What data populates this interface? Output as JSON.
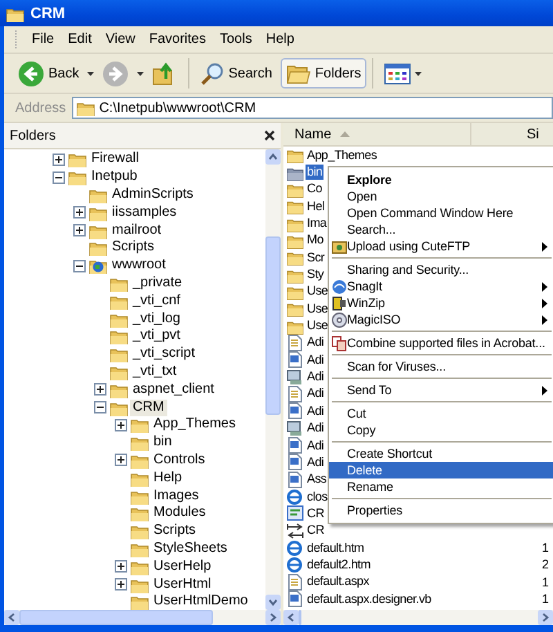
{
  "window": {
    "title": "CRM"
  },
  "menu_bar": [
    "File",
    "Edit",
    "View",
    "Favorites",
    "Tools",
    "Help"
  ],
  "toolbar": [
    {
      "kind": "back",
      "label": "Back",
      "disabled": false
    },
    {
      "kind": "forward",
      "disabled": true
    },
    {
      "kind": "up"
    },
    {
      "kind": "search",
      "label": "Search",
      "selected": false
    },
    {
      "kind": "folders",
      "label": "Folders",
      "selected": true
    },
    {
      "kind": "views"
    }
  ],
  "address_bar": {
    "label": "Address",
    "value": "C:\\Inetpub\\wwwroot\\CRM"
  },
  "folders_pane": {
    "title": "Folders",
    "tree": [
      {
        "label": "Firewall",
        "kind": "folder",
        "expanded": false,
        "selected": false
      },
      {
        "label": "Inetpub",
        "kind": "folder",
        "expanded": true,
        "selected": false,
        "children": [
          {
            "label": "AdminScripts",
            "kind": "folder",
            "selected": false
          },
          {
            "label": "iissamples",
            "kind": "folder",
            "expanded": false,
            "selected": false
          },
          {
            "label": "mailroot",
            "kind": "folder",
            "expanded": false,
            "selected": false
          },
          {
            "label": "Scripts",
            "kind": "folder",
            "selected": false
          },
          {
            "label": "wwwroot",
            "kind": "web-folder",
            "expanded": true,
            "selected": false,
            "children": [
              {
                "label": "_private",
                "kind": "folder",
                "selected": false
              },
              {
                "label": "_vti_cnf",
                "kind": "folder",
                "selected": false
              },
              {
                "label": "_vti_log",
                "kind": "folder",
                "selected": false
              },
              {
                "label": "_vti_pvt",
                "kind": "folder",
                "selected": false
              },
              {
                "label": "_vti_script",
                "kind": "folder",
                "selected": false
              },
              {
                "label": "_vti_txt",
                "kind": "folder",
                "selected": false
              },
              {
                "label": "aspnet_client",
                "kind": "folder",
                "expanded": false,
                "selected": false
              },
              {
                "label": "CRM",
                "kind": "folder",
                "expanded": true,
                "selected": true,
                "children": [
                  {
                    "label": "App_Themes",
                    "kind": "folder",
                    "expanded": false,
                    "selected": false
                  },
                  {
                    "label": "bin",
                    "kind": "folder",
                    "selected": false
                  },
                  {
                    "label": "Controls",
                    "kind": "folder",
                    "expanded": false,
                    "selected": false
                  },
                  {
                    "label": "Help",
                    "kind": "folder",
                    "selected": false
                  },
                  {
                    "label": "Images",
                    "kind": "folder",
                    "selected": false
                  },
                  {
                    "label": "Modules",
                    "kind": "folder",
                    "selected": false
                  },
                  {
                    "label": "Scripts",
                    "kind": "folder",
                    "selected": false
                  },
                  {
                    "label": "StyleSheets",
                    "kind": "folder",
                    "selected": false
                  },
                  {
                    "label": "UserHelp",
                    "kind": "folder",
                    "expanded": false,
                    "selected": false
                  },
                  {
                    "label": "UserHtml",
                    "kind": "folder",
                    "expanded": false,
                    "selected": false
                  },
                  {
                    "label": "UserHtmlDemo",
                    "kind": "folder",
                    "selected": false
                  }
                ]
              }
            ]
          }
        ]
      }
    ]
  },
  "file_list": {
    "columns": [
      {
        "label": "Name",
        "sorted": true
      },
      {
        "label": "Si",
        "sorted": false
      }
    ],
    "rows": [
      {
        "name": "App_Themes",
        "kind": "folder",
        "selected": false
      },
      {
        "name": "bin",
        "kind": "folder",
        "selected": true
      },
      {
        "name": "Co",
        "kind": "folder",
        "selected": false
      },
      {
        "name": "Hel",
        "kind": "folder",
        "selected": false
      },
      {
        "name": "Ima",
        "kind": "folder",
        "selected": false
      },
      {
        "name": "Mo",
        "kind": "folder",
        "selected": false
      },
      {
        "name": "Scr",
        "kind": "folder",
        "selected": false
      },
      {
        "name": "Sty",
        "kind": "folder",
        "selected": false
      },
      {
        "name": "Use",
        "kind": "folder",
        "selected": false
      },
      {
        "name": "Use",
        "kind": "folder",
        "selected": false
      },
      {
        "name": "Use",
        "kind": "folder",
        "selected": false
      },
      {
        "name": "Adi",
        "kind": "text",
        "selected": false
      },
      {
        "name": "Adi",
        "kind": "code",
        "selected": false
      },
      {
        "name": "Adi",
        "kind": "service",
        "selected": false
      },
      {
        "name": "Adi",
        "kind": "text",
        "selected": false
      },
      {
        "name": "Adi",
        "kind": "code",
        "selected": false
      },
      {
        "name": "Adi",
        "kind": "service",
        "selected": false
      },
      {
        "name": "Adi",
        "kind": "code",
        "selected": false
      },
      {
        "name": "Adi",
        "kind": "code",
        "selected": false
      },
      {
        "name": "Ass",
        "kind": "code",
        "selected": false
      },
      {
        "name": "clos",
        "kind": "web",
        "selected": false
      },
      {
        "name": "CR",
        "kind": "project",
        "selected": false
      },
      {
        "name": "CR",
        "kind": "link",
        "selected": false
      },
      {
        "name": "default.htm",
        "kind": "web",
        "selected": false,
        "size": "1"
      },
      {
        "name": "default2.htm",
        "kind": "web",
        "selected": false,
        "size": "2"
      },
      {
        "name": "default.aspx",
        "kind": "text",
        "selected": false,
        "size": "1"
      },
      {
        "name": "default.aspx.designer.vb",
        "kind": "code",
        "selected": false,
        "size": "1"
      }
    ]
  },
  "context_menu": {
    "items": [
      {
        "kind": "item",
        "label": "Explore",
        "default": true,
        "submenu": false,
        "selected": false
      },
      {
        "kind": "item",
        "label": "Open",
        "default": false,
        "submenu": false,
        "selected": false
      },
      {
        "kind": "item",
        "label": "Open Command Window Here",
        "default": false,
        "submenu": false,
        "selected": false
      },
      {
        "kind": "item",
        "label": "Search...",
        "default": false,
        "submenu": false,
        "selected": false
      },
      {
        "kind": "item",
        "label": "Upload using CuteFTP",
        "default": false,
        "submenu": true,
        "selected": false
      },
      {
        "kind": "separator"
      },
      {
        "kind": "item",
        "label": "Sharing and Security...",
        "default": false,
        "submenu": false,
        "selected": false
      },
      {
        "kind": "item",
        "label": "SnagIt",
        "default": false,
        "submenu": true,
        "selected": false
      },
      {
        "kind": "item",
        "label": "WinZip",
        "default": false,
        "submenu": true,
        "selected": false
      },
      {
        "kind": "item",
        "label": "MagicISO",
        "default": false,
        "submenu": true,
        "selected": false
      },
      {
        "kind": "separator"
      },
      {
        "kind": "item",
        "label": "Combine supported files in Acrobat...",
        "default": false,
        "submenu": false,
        "selected": false
      },
      {
        "kind": "separator"
      },
      {
        "kind": "item",
        "label": "Scan for Viruses...",
        "default": false,
        "submenu": false,
        "selected": false
      },
      {
        "kind": "separator"
      },
      {
        "kind": "item",
        "label": "Send To",
        "default": false,
        "submenu": true,
        "selected": false
      },
      {
        "kind": "separator"
      },
      {
        "kind": "item",
        "label": "Cut",
        "default": false,
        "submenu": false,
        "selected": false
      },
      {
        "kind": "item",
        "label": "Copy",
        "default": false,
        "submenu": false,
        "selected": false
      },
      {
        "kind": "separator"
      },
      {
        "kind": "item",
        "label": "Create Shortcut",
        "default": false,
        "submenu": false,
        "selected": false
      },
      {
        "kind": "item",
        "label": "Delete",
        "default": false,
        "submenu": false,
        "selected": true
      },
      {
        "kind": "item",
        "label": "Rename",
        "default": false,
        "submenu": false,
        "selected": false
      },
      {
        "kind": "separator"
      },
      {
        "kind": "item",
        "label": "Properties",
        "default": false,
        "submenu": false,
        "selected": false
      }
    ]
  }
}
